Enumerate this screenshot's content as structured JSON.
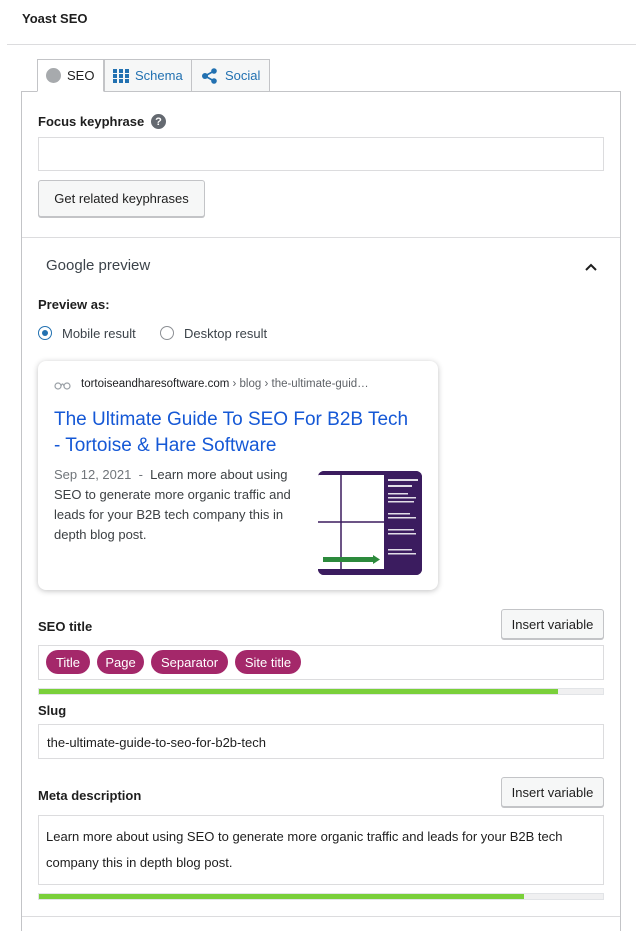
{
  "header": {
    "title": "Yoast SEO"
  },
  "tabs": [
    {
      "label": "SEO",
      "icon": "circle-icon",
      "active": true
    },
    {
      "label": "Schema",
      "icon": "grid-icon",
      "active": false
    },
    {
      "label": "Social",
      "icon": "share-icon",
      "active": false
    }
  ],
  "focus": {
    "label": "Focus keyphrase",
    "help": "?",
    "value": "",
    "button": "Get related keyphrases"
  },
  "google_preview": {
    "title": "Google preview",
    "preview_as": "Preview as:",
    "options": [
      "Mobile result",
      "Desktop result"
    ],
    "selected": "Mobile result",
    "card": {
      "domain": "tortoiseandharesoftware.com",
      "path": " › blog › the-ultimate-guid…",
      "title": "The Ultimate Guide To SEO For B2B Tech - Tortoise & Hare Software",
      "date": "Sep 12, 2021",
      "dash": "  -  ",
      "description": "Learn more about using SEO to generate more organic traffic and leads for your B2B tech company this in depth blog post."
    }
  },
  "seo_title": {
    "label": "SEO title",
    "insert": "Insert variable",
    "pills": [
      "Title",
      "Page",
      "Separator",
      "Site title"
    ],
    "progress": 0.92
  },
  "slug": {
    "label": "Slug",
    "value": "the-ultimate-guide-to-seo-for-b2b-tech"
  },
  "meta": {
    "label": "Meta description",
    "insert": "Insert variable",
    "value": "Learn more about using SEO to generate more organic traffic and leads for your B2B tech company this in depth blog post.",
    "progress": 0.86
  },
  "colors": {
    "link": "#2271b1",
    "pill": "#a4286a",
    "progress": "#7ad03a",
    "google_title": "#1558d6"
  }
}
